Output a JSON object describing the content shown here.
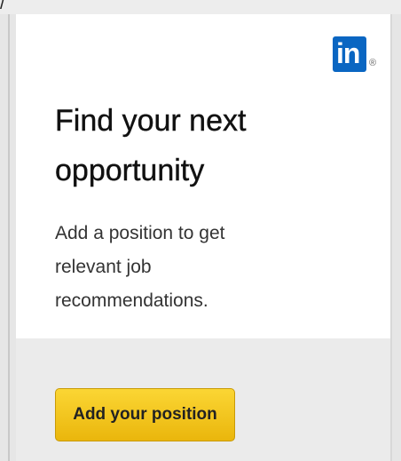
{
  "brand": {
    "logo_text": "in",
    "registered_mark": "®",
    "color": "#0a66c2"
  },
  "card": {
    "title": "Find your next opportunity",
    "description": "Add a position to get relevant job recommendations."
  },
  "action": {
    "button_label": "Add your position",
    "button_color": "#f5c518"
  },
  "chrome": {
    "corner_glyph": "/"
  }
}
